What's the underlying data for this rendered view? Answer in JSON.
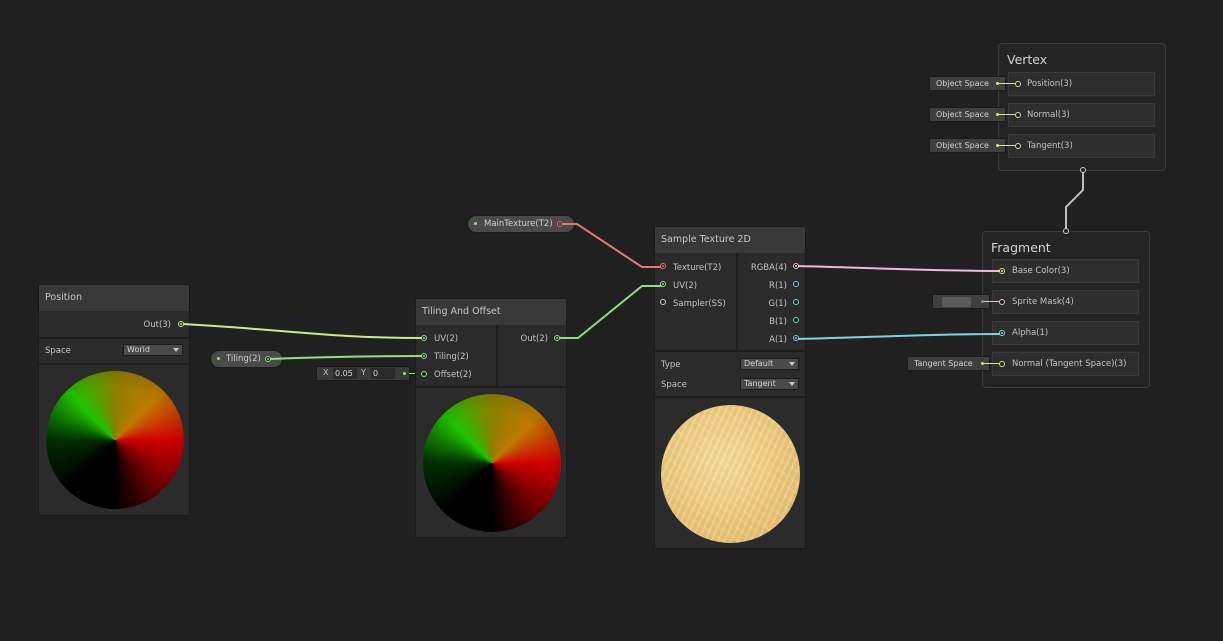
{
  "colors": {
    "background": "#202020",
    "wire_vector3": "#ccea8a",
    "wire_vector2": "#8ee07a",
    "wire_texture": "#e07a72",
    "wire_vector4": "#ebbbd9",
    "wire_float": "#7fd3dc",
    "wire_vertex_link": "#bdbdbd"
  },
  "vertex": {
    "title": "Vertex",
    "slots": [
      {
        "label": "Position(3)",
        "space": "Object Space"
      },
      {
        "label": "Normal(3)",
        "space": "Object Space"
      },
      {
        "label": "Tangent(3)",
        "space": "Object Space"
      }
    ]
  },
  "fragment": {
    "title": "Fragment",
    "slots": [
      {
        "label": "Base Color(3)"
      },
      {
        "label": "Sprite Mask(4)"
      },
      {
        "label": "Alpha(1)"
      },
      {
        "label": "Normal (Tangent Space)(3)",
        "space": "Tangent Space"
      }
    ]
  },
  "position_node": {
    "title": "Position",
    "output": "Out(3)",
    "space_label": "Space",
    "space_value": "World"
  },
  "tiling_property": {
    "label": "Tiling(2)"
  },
  "offset_field": {
    "x_label": "X",
    "x_value": "0.05",
    "y_label": "Y",
    "y_value": "0"
  },
  "tiling_node": {
    "title": "Tiling And Offset",
    "inputs": [
      "UV(2)",
      "Tiling(2)",
      "Offset(2)"
    ],
    "output": "Out(2)"
  },
  "maintexture_property": {
    "label": "MainTexture(T2)"
  },
  "sample_node": {
    "title": "Sample Texture 2D",
    "inputs": [
      "Texture(T2)",
      "UV(2)",
      "Sampler(SS)"
    ],
    "outputs": [
      "RGBA(4)",
      "R(1)",
      "G(1)",
      "B(1)",
      "A(1)"
    ],
    "type_label": "Type",
    "type_value": "Default",
    "space_label": "Space",
    "space_value": "Tangent"
  }
}
